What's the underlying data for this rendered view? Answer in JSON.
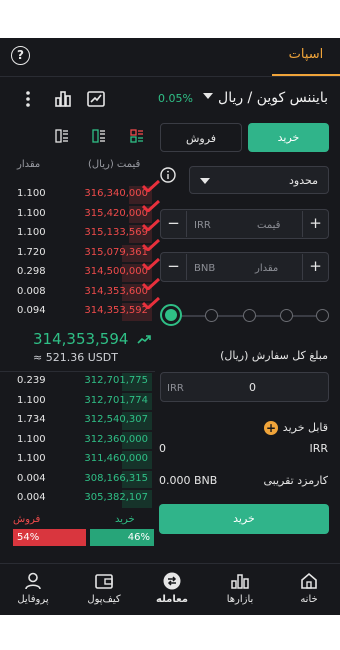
{
  "header": {
    "tab_spot": "اسپات",
    "help": "?"
  },
  "pair": {
    "name": "بایننس کوین / ریال",
    "change": "0.05%"
  },
  "orderbook": {
    "head_amount": "مقدار",
    "head_price": "قیمت (ریال)",
    "asks": [
      {
        "amount": "1.100",
        "price": "316,340,000",
        "depth": 0.15
      },
      {
        "amount": "1.100",
        "price": "315,420,000",
        "depth": 0.15
      },
      {
        "amount": "1.100",
        "price": "315,133,569",
        "depth": 0.15
      },
      {
        "amount": "1.720",
        "price": "315,079,361",
        "depth": 0.2
      },
      {
        "amount": "0.298",
        "price": "314,500,000",
        "depth": 0.2
      },
      {
        "amount": "0.008",
        "price": "314,353,600",
        "depth": 0.2
      },
      {
        "amount": "0.094",
        "price": "314,353,592",
        "depth": 0.2
      }
    ],
    "last_price": "314,353,594",
    "last_usdt": "≈ 521.36 USDT",
    "bids": [
      {
        "amount": "0.239",
        "price": "312,701,775",
        "depth": 0.2
      },
      {
        "amount": "1.100",
        "price": "312,701,774",
        "depth": 0.2
      },
      {
        "amount": "1.734",
        "price": "312,540,307",
        "depth": 0.2
      },
      {
        "amount": "1.100",
        "price": "312,360,000",
        "depth": 0.2
      },
      {
        "amount": "1.100",
        "price": "311,460,000",
        "depth": 0.2
      },
      {
        "amount": "0.004",
        "price": "308,166,315",
        "depth": 0.2
      },
      {
        "amount": "0.004",
        "price": "305,382,107",
        "depth": 0.2
      }
    ],
    "sell_label": "فروش",
    "buy_label": "خرید",
    "sell_pct": "54%",
    "buy_pct": "46%",
    "sell_ratio": 0.54,
    "buy_ratio": 0.46
  },
  "form": {
    "buy_tab": "خرید",
    "sell_tab": "فروش",
    "order_type": "محدود",
    "price_unit": "IRR",
    "price_placeholder": "قیمت",
    "amount_unit": "BNB",
    "amount_placeholder": "مقدار",
    "total_label": "مبلغ کل سفارش (ریال)",
    "total_unit": "IRR",
    "total_value": "0",
    "available_label": "قابل خرید",
    "available_unit": "IRR",
    "available_value": "0",
    "fee_label": "کارمزد تقریبی",
    "fee_unit": "BNB",
    "fee_value": "0.000",
    "submit": "خرید"
  },
  "nav": {
    "home": "خانه",
    "markets": "بازارها",
    "trade": "معامله",
    "wallet": "کیف‌پول",
    "profile": "پروفایل"
  },
  "colors": {
    "green": "#2fbf86",
    "red": "#f04b4b",
    "accent": "#f0a43a",
    "bg": "#17181c"
  }
}
